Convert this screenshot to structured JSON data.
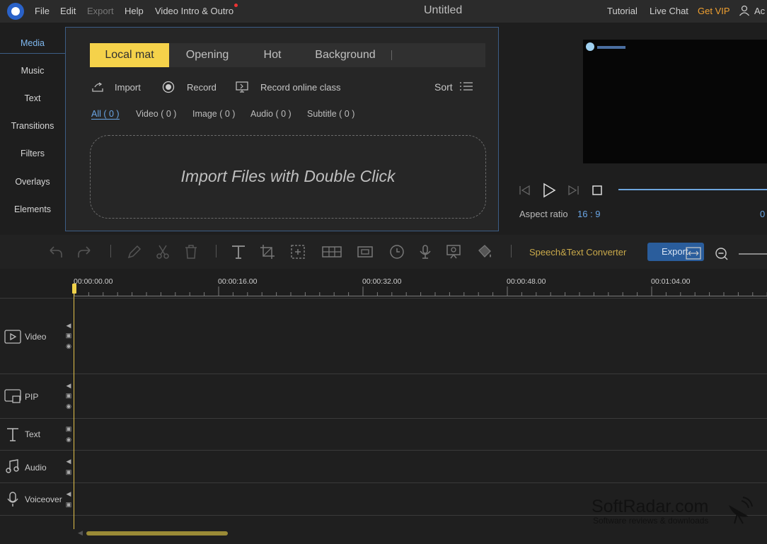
{
  "menu": {
    "file": "File",
    "edit": "Edit",
    "export": "Export",
    "help": "Help",
    "video_intro": "Video Intro & Outro"
  },
  "window_title": "Untitled",
  "header_links": {
    "tutorial": "Tutorial",
    "live_chat": "Live Chat",
    "get_vip": "Get VIP",
    "account": "Ac"
  },
  "sidebar": {
    "items": [
      {
        "label": "Media",
        "active": true
      },
      {
        "label": "Music"
      },
      {
        "label": "Text"
      },
      {
        "label": "Transitions"
      },
      {
        "label": "Filters"
      },
      {
        "label": "Overlays"
      },
      {
        "label": "Elements"
      }
    ]
  },
  "media": {
    "tabs": [
      {
        "label": "Local mat",
        "active": true
      },
      {
        "label": "Opening"
      },
      {
        "label": "Hot"
      },
      {
        "label": "Background"
      }
    ],
    "tools": {
      "import": "Import",
      "record": "Record",
      "record_online": "Record online class",
      "sort": "Sort"
    },
    "filters": {
      "all": "All ( 0 )",
      "video": "Video ( 0 )",
      "image": "Image ( 0 )",
      "audio": "Audio ( 0 )",
      "subtitle": "Subtitle ( 0 )"
    },
    "dropzone_text": "Import Files with Double Click"
  },
  "preview": {
    "aspect_label": "Aspect ratio",
    "aspect_value": "16 : 9",
    "time_partial": "0"
  },
  "toolbar": {
    "speech_text": "Speech&Text Converter",
    "export_label": "Export"
  },
  "ruler": {
    "marks": [
      "00:00:00.00",
      "00:00:16.00",
      "00:00:32.00",
      "00:00:48.00",
      "00:01:04.00"
    ]
  },
  "tracks": {
    "video": "Video",
    "pip": "PIP",
    "text": "Text",
    "audio": "Audio",
    "voiceover": "Voiceover"
  },
  "watermark": {
    "title": "SoftRadar.com",
    "subtitle": "Software reviews & downloads"
  },
  "colors": {
    "accent_yellow": "#f5d24a",
    "accent_blue": "#6aa6e6",
    "vip_orange": "#f0a030",
    "speech_gold": "#c9a94a"
  }
}
